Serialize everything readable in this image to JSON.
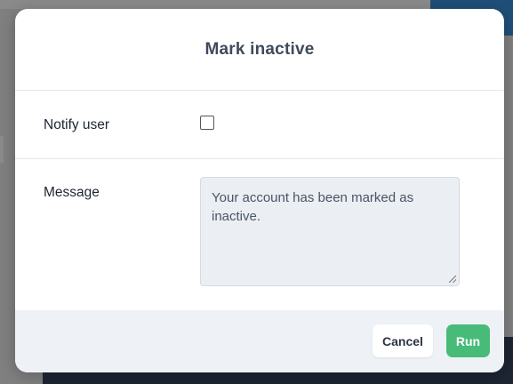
{
  "modal": {
    "title": "Mark inactive",
    "fields": {
      "notify_user": {
        "label": "Notify user",
        "checked": false
      },
      "message": {
        "label": "Message",
        "value": "Your account has been marked as inactive."
      }
    },
    "actions": {
      "cancel_label": "Cancel",
      "run_label": "Run"
    }
  },
  "colors": {
    "run_button": "#48bb78",
    "footer": "#eef2f6",
    "textarea": "#ebeff4"
  }
}
